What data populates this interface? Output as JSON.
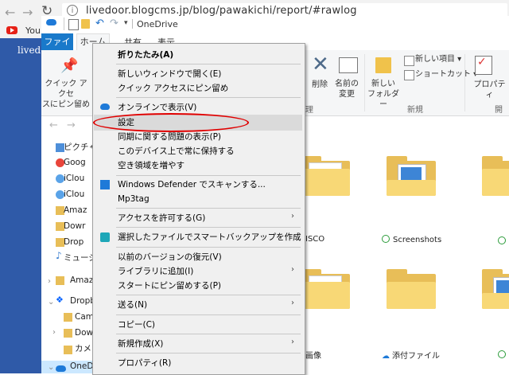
{
  "browser": {
    "url": "livedoor.blogcms.jp/blog/pawakichi/report/#rawlog",
    "bookmark_youtube": "You",
    "blog_text": "livedo"
  },
  "explorer": {
    "title": "OneDrive",
    "tabs": {
      "file": "ファイル",
      "home": "ホーム",
      "share": "共有",
      "view": "表示"
    },
    "ribbon": {
      "pin_label_1": "クイック アクセ",
      "pin_label_2": "スにピン留め",
      "delete_label": "削除",
      "rename_label_1": "名前の",
      "rename_label_2": "変更",
      "new_folder_label_1": "新しい",
      "new_folder_label_2": "フォルダー",
      "new_item_label": "新しい項目 ▾",
      "shortcut_label": "ショートカット ▾",
      "new_group_label": "新規",
      "organize_group_tail": "理",
      "properties_label": "プロパティ",
      "open_group_tail": "開く"
    },
    "nav_items": [
      "ピクチャ",
      "Goog",
      "iClou",
      "iClou",
      "Amaz",
      "Dowr",
      "Drop",
      "ミュージ",
      "Amazo",
      "Dropbo",
      "Came",
      "Dowr",
      "カメラ",
      "OneDri"
    ],
    "files": {
      "f1": "ISCO",
      "f2": "Screenshots",
      "f3": "画像",
      "f4": "添付ファイル"
    }
  },
  "context_menu": {
    "items": [
      "折りたたみ(A)",
      "新しいウィンドウで開く(E)",
      "クイック アクセスにピン留め",
      "オンラインで表示(V)",
      "設定",
      "同期に関する問題の表示(P)",
      "このデバイス上で常に保持する",
      "空き領域を増やす",
      "Windows Defender でスキャンする...",
      "Mp3tag",
      "アクセスを許可する(G)",
      "選択したファイルでスマートバックアップを作成",
      "以前のバージョンの復元(V)",
      "ライブラリに追加(I)",
      "スタートにピン留めする(P)",
      "送る(N)",
      "コピー(C)",
      "新規作成(X)",
      "プロパティ(R)"
    ],
    "highlighted": "設定"
  },
  "colors": {
    "accent": "#1979ca",
    "highlight_ring": "#e00000",
    "folder": "#f8d876"
  }
}
